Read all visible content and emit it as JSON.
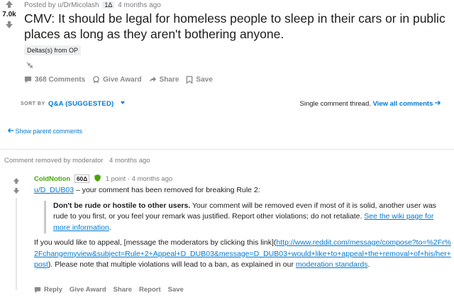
{
  "post": {
    "score": "7.0k",
    "meta_posted_by": "Posted by",
    "meta_user": "u/DrMicolash",
    "meta_award": "1Δ",
    "meta_time": "4 months ago",
    "title": "CMV: It should be legal for homeless people to sleep in their cars or in public places as long as they aren't bothering anyone.",
    "flair": "Deltas(s) from OP",
    "actions": {
      "comments": "368 Comments",
      "award": "Give Award",
      "share": "Share",
      "save": "Save"
    }
  },
  "sort": {
    "label": "SORT BY",
    "value": "Q&A (SUGGESTED)"
  },
  "thread": {
    "info": "Single comment thread.",
    "view_all": "View all comments",
    "show_parent": "Show parent comments"
  },
  "removed_comment": {
    "note": "Comment removed by moderator",
    "time": "4 months ago"
  },
  "comment": {
    "user": "ColdNotion",
    "delta": "60Δ",
    "points": "1 point",
    "time": "4 months ago",
    "mention": "u/D_DUB03",
    "line1": " – your comment has been removed for breaking Rule 2:",
    "quote_bold": "Don't be rude or hostile to other users.",
    "quote_text": " Your comment will be removed even if most of it is solid, another user was rude to you first, or you feel your remark was justified. Report other violations; do not retaliate. ",
    "quote_link": "See the wiki page for more information",
    "appeal_pre": "If you would like to appeal, [message the moderators by clicking this link](",
    "appeal_link": "http://www.reddit.com/message/compose?to=%2Fr%2Fchangemyview&subject=Rule+2+Appeal+D_DUB03&message=D_DUB03+would+like+to+appeal+the+removal+of+his/her+post",
    "appeal_post": "). Please note that multiple violations will lead to a ban, as explained in our ",
    "appeal_link2": "moderation standards",
    "appeal_end": ".",
    "actions": {
      "reply": "Reply",
      "award": "Give Award",
      "share": "Share",
      "report": "Report",
      "save": "Save"
    }
  },
  "colors": {
    "accent": "#0079d3",
    "username_green": "#46a508",
    "muted": "#7c7c7c"
  }
}
